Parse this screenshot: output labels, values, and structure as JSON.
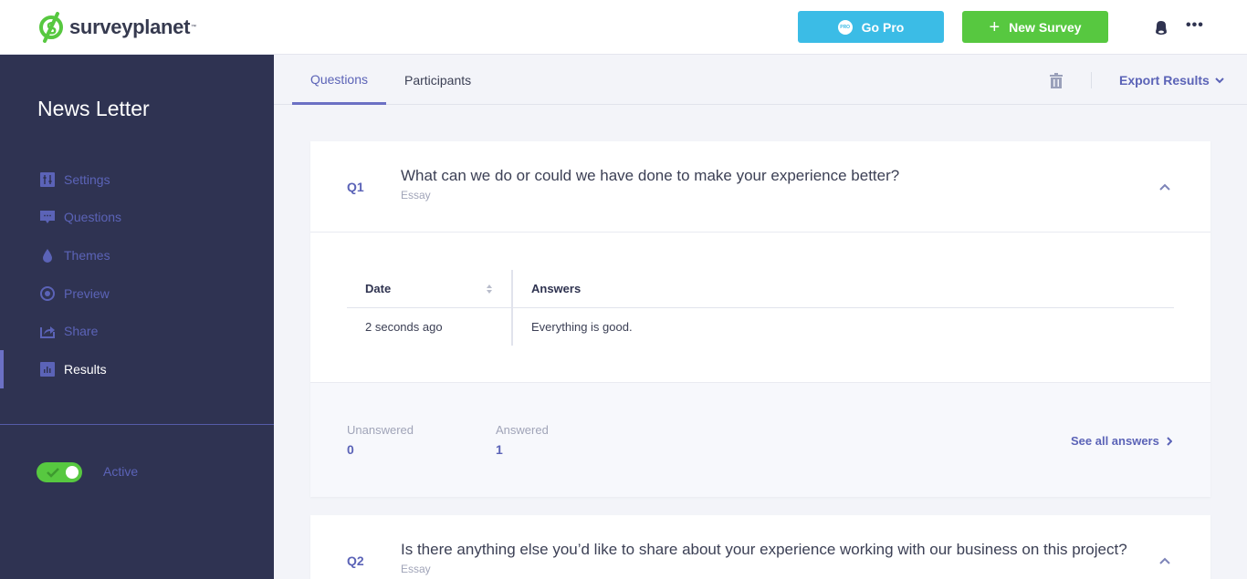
{
  "brand": {
    "name": "surveyplanet",
    "tm": "™",
    "green": "#57c840"
  },
  "header": {
    "go_pro_label": "Go Pro",
    "pro_badge": "PRO",
    "new_survey_label": "New Survey",
    "new_survey_icon": "+",
    "more_icon": "•••"
  },
  "sidebar": {
    "survey_title": "News Letter",
    "items": [
      {
        "label": "Settings",
        "icon": "sliders-icon"
      },
      {
        "label": "Questions",
        "icon": "chat-icon"
      },
      {
        "label": "Themes",
        "icon": "drop-icon"
      },
      {
        "label": "Preview",
        "icon": "eye-icon"
      },
      {
        "label": "Share",
        "icon": "share-icon"
      },
      {
        "label": "Results",
        "icon": "chart-icon",
        "active": true
      }
    ],
    "status_label": "Active",
    "status_on": true
  },
  "tabs": {
    "questions": "Questions",
    "participants": "Participants",
    "active": "Questions",
    "export_label": "Export Results"
  },
  "questions": [
    {
      "number": "Q1",
      "text": "What can we do or could we have done to make your experience better?",
      "type": "Essay",
      "table": {
        "columns": [
          "Date",
          "Answers"
        ],
        "rows": [
          {
            "date": "2 seconds ago",
            "answer": "Everything is good."
          }
        ]
      },
      "stats": {
        "unanswered_label": "Unanswered",
        "unanswered": "0",
        "answered_label": "Answered",
        "answered": "1"
      },
      "see_all_label": "See all answers"
    },
    {
      "number": "Q2",
      "text": "Is there anything else you’d like to share about your experience working with our business on this project?",
      "type": "Essay"
    }
  ],
  "colors": {
    "accent": "#5b63b7",
    "sidebar_bg": "#2f3352",
    "go_pro": "#3bbce6",
    "new_survey": "#57c840"
  }
}
